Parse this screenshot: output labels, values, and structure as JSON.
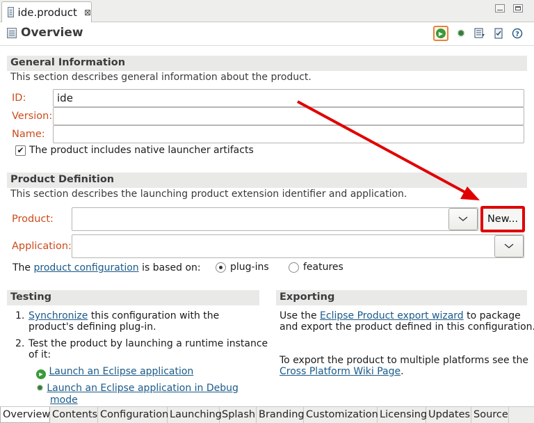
{
  "editor_tab": {
    "label": "ide.product",
    "close": "⊠"
  },
  "header": {
    "title": "Overview"
  },
  "general": {
    "heading": "General Information",
    "description": "This section describes general information about the product.",
    "id_label": "ID:",
    "id_value": "ide",
    "version_label": "Version:",
    "version_value": "",
    "name_label": "Name:",
    "name_value": "",
    "launcher_checkbox_label": "The product includes native launcher artifacts",
    "launcher_checked": true
  },
  "definition": {
    "heading": "Product Definition",
    "description": "This section describes the launching product extension identifier and application.",
    "product_label": "Product:",
    "product_value": "",
    "new_button": "New...",
    "application_label": "Application:",
    "application_value": "",
    "config_prefix": "The",
    "config_link": "product configuration",
    "config_suffix": "is based on:",
    "radio_plugins": "plug-ins",
    "radio_features": "features",
    "selected": "plug-ins"
  },
  "testing": {
    "heading": "Testing",
    "step1_number": "1.",
    "step1_link": "Synchronize",
    "step1_text_a": "this configuration with the",
    "step1_text_b": "product's defining plug-in.",
    "step2_number": "2.",
    "step2_text_a": "Test the product by launching a runtime instance",
    "step2_text_b": "of it:",
    "launch_link": "Launch an Eclipse application",
    "debug_link_a": "Launch an Eclipse application in Debug",
    "debug_link_b": "mode"
  },
  "exporting": {
    "heading": "Exporting",
    "line1_prefix": "Use the",
    "line1_link": "Eclipse Product export wizard",
    "line1_suffix": "to package",
    "line2": "and export the product defined in this configuration.",
    "line3": "To export the product to multiple platforms see the",
    "line4_link": "Cross Platform Wiki Page",
    "line4_suffix": "."
  },
  "bottom_tabs": [
    "Overview",
    "Contents",
    "Configuration",
    "Launching",
    "Splash",
    "Branding",
    "Customization",
    "Licensing",
    "Updates",
    "Source"
  ],
  "active_bottom_tab": "Overview",
  "annotation": {
    "color": "#e00000"
  }
}
